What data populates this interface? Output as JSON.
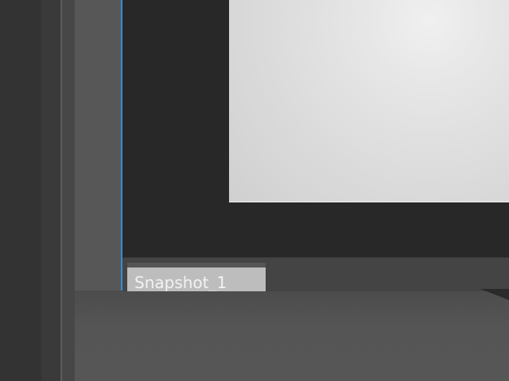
{
  "app": {
    "accent_color": "#2f8fd6"
  },
  "snapshot_window": {
    "tabs": [
      {
        "label": "Snapshot_1",
        "selected": true
      }
    ]
  },
  "icons": {
    "render_object": "render-preview-object"
  }
}
